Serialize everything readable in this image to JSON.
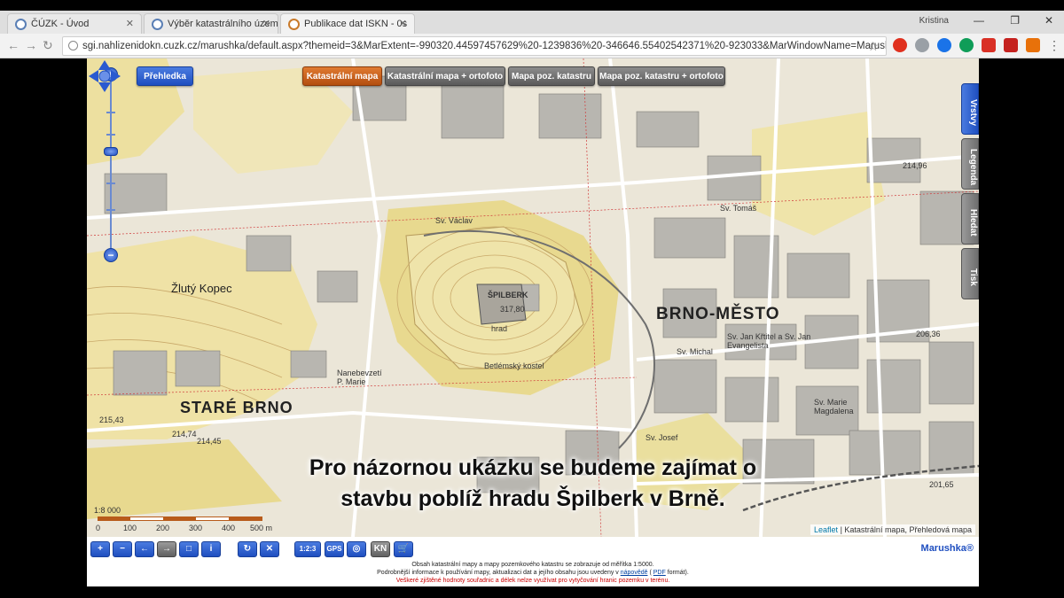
{
  "browser": {
    "tabs": [
      {
        "title": "ČÚZK - Úvod",
        "active": false
      },
      {
        "title": "Výběr katastrálního územ",
        "active": false
      },
      {
        "title": "Publikace dat ISKN - 0s",
        "active": true
      }
    ],
    "user": "Kristina",
    "url": "sgi.nahlizenidokn.cuzk.cz/marushka/default.aspx?themeid=3&MarExtent=-990320.44597457629%20-1239836%20-346646.55402542371%20-923033&MarWindowName=Marushka",
    "back_icon": "back-arrow-icon",
    "forward_icon": "forward-arrow-icon",
    "reload_icon": "reload-icon",
    "extension_colors": [
      "#e0301e",
      "#9aa0a6",
      "#1a73e8",
      "#0f9d58",
      "#d93025",
      "#c5221f",
      "#e8710a"
    ]
  },
  "map": {
    "overview_button": "Přehledka",
    "layer_buttons": [
      {
        "label": "Katastrální mapa",
        "active": true
      },
      {
        "label": "Katastrální mapa + ortofoto",
        "active": false
      },
      {
        "label": "Mapa poz. katastru",
        "active": false
      },
      {
        "label": "Mapa poz. katastru + ortofoto",
        "active": false
      }
    ],
    "side_tabs": [
      {
        "label": "Vrstvy",
        "active": true
      },
      {
        "label": "Legenda",
        "active": false
      },
      {
        "label": "Hledat",
        "active": false
      },
      {
        "label": "Tisk",
        "active": false
      }
    ],
    "place_labels": {
      "stare_brno": "STARÉ BRNO",
      "brno_mesto": "BRNO-MĚSTO",
      "zluty_kopec": "Žlutý Kopec",
      "spilberk": "ŠPILBERK",
      "sv_vaclav": "Sv. Václav",
      "sv_tomas": "Sv. Tomáš",
      "sv_jan_krtitel": "Sv. Jan Křtitel a Sv. Jan Evangelista",
      "sv_michal": "Sv. Michal",
      "sv_maria_magdalena": "Sv. Marie Magdalena",
      "sv_josef": "Sv. Josef",
      "nanebevzeti": "Nanebevzetí P. Marie",
      "betlemsky": "Betlémský kostel",
      "hrad": "hrad"
    },
    "elevations": [
      "215,43",
      "214,74",
      "214,45",
      "317,80",
      "206,36",
      "201,65",
      "214,96"
    ],
    "subtitle_line1": "Pro názornou ukázku se budeme zajímat o",
    "subtitle_line2": "stavbu poblíž hradu Špilberk v Brně.",
    "scale": {
      "ratio": "1:8 000",
      "ticks": [
        "0",
        "100",
        "200",
        "300",
        "400",
        "500 m"
      ]
    },
    "attribution": {
      "leaflet": "Leaflet",
      "text": "| Katastrální mapa, Přehledová mapa"
    }
  },
  "bottom": {
    "tools": [
      "+",
      "−",
      "←",
      "→",
      "□",
      "i",
      "↻",
      "✕",
      "1:2:3",
      "GPS",
      "◎",
      "KN",
      "🛒"
    ],
    "brand": "Marushka®",
    "info_line1": "Obsah katastrální mapy a mapy pozemkového katastru se zobrazuje od měřítka 1:5000.",
    "info_line2a": "Podrobnější informace k používání mapy, aktualizaci dat a jejího obsahu jsou uvedeny v",
    "info_link1": "nápovědě",
    "info_line2b": "(",
    "info_link2": "PDF",
    "info_line2c": "formát).",
    "info_line3": "Veškeré zjištěné hodnoty souřadnic a délek nelze využívat pro vytyčování hranic pozemku v terénu."
  }
}
